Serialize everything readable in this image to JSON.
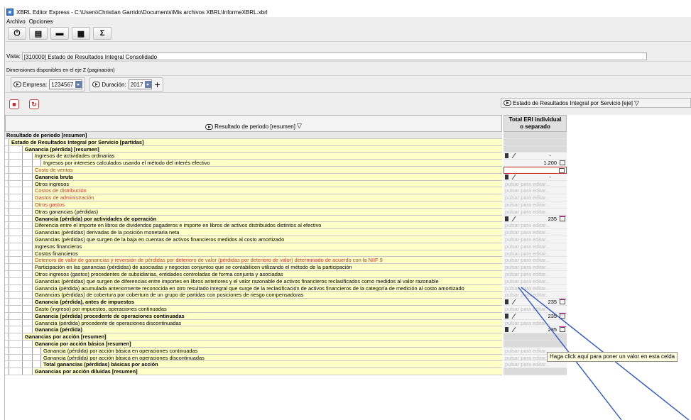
{
  "window": {
    "title": "XBRL Editor Express - C:\\Users\\Christian Garrido\\Documents\\Mis archivos XBRL\\InformeXBRL.xbrl"
  },
  "menu": [
    "Archivo",
    "Opciones"
  ],
  "toolbar": [
    {
      "icon": "power-icon",
      "glyph": "⏻"
    },
    {
      "icon": "open-file-icon",
      "glyph": "▤"
    },
    {
      "icon": "print-icon",
      "glyph": "▬"
    },
    {
      "icon": "table-icon",
      "glyph": "▦"
    },
    {
      "icon": "sigma-icon",
      "glyph": "Σ"
    }
  ],
  "vista": {
    "label": "Vista:",
    "value": "[310000] Estado de Resultados Integral Consolidado"
  },
  "dimensiones_label": "Dimensiones disponibles en el eje Z (paginación)",
  "dims": {
    "empresa_label": "Empresa:",
    "empresa_value": "1234567",
    "duracion_label": "Duración:",
    "duracion_value": "2017",
    "plus": "+"
  },
  "eri_header": "Estado de Resultados Integral por Servicio [eje]",
  "row_header": "Resultado de periodo [resumen]",
  "col_header": [
    "Total ERI individual",
    "o separado"
  ],
  "rows": [
    {
      "label": "Resultado de periodo [resumen]",
      "lvl": 0,
      "bold": true,
      "y": false,
      "red": false,
      "cell": {
        "t": "blank",
        "dark": true
      }
    },
    {
      "label": "Estado de Resultados Integral por Servicio [partidas]",
      "lvl": 1,
      "bold": true,
      "y": true,
      "red": false,
      "cell": {
        "t": "blank",
        "dark": true
      }
    },
    {
      "label": "Ganancia (pérdida) [resumen]",
      "lvl": 2,
      "bold": true,
      "y": true,
      "red": false,
      "cell": {
        "t": "blank",
        "dark": true
      }
    },
    {
      "label": "Ingresos de actividades ordinarias",
      "lvl": 3,
      "bold": false,
      "y": true,
      "red": false,
      "cell": {
        "t": "calc",
        "v": "-"
      }
    },
    {
      "label": "Ingresos por intereses calculados usando el método del interés efectivo",
      "lvl": 4,
      "bold": false,
      "y": true,
      "red": false,
      "cell": {
        "t": "val",
        "v": "1.200"
      }
    },
    {
      "label": "Costo de ventas",
      "lvl": 3,
      "bold": false,
      "y": true,
      "red": true,
      "cell": {
        "t": "edit",
        "v": ""
      }
    },
    {
      "label": "Ganancia bruta",
      "lvl": 3,
      "bold": true,
      "y": true,
      "red": false,
      "cell": {
        "t": "calc",
        "v": "-"
      }
    },
    {
      "label": "Otros ingresos",
      "lvl": 3,
      "bold": false,
      "y": true,
      "red": false,
      "cell": {
        "t": "ph"
      }
    },
    {
      "label": "Costos de distribución",
      "lvl": 3,
      "bold": false,
      "y": true,
      "red": true,
      "cell": {
        "t": "ph"
      }
    },
    {
      "label": "Gastos de administración",
      "lvl": 3,
      "bold": false,
      "y": true,
      "red": true,
      "cell": {
        "t": "ph"
      }
    },
    {
      "label": "Otros gastos",
      "lvl": 3,
      "bold": false,
      "y": true,
      "red": true,
      "cell": {
        "t": "ph"
      }
    },
    {
      "label": "Otras ganancias (pérdidas)",
      "lvl": 3,
      "bold": false,
      "y": true,
      "red": false,
      "cell": {
        "t": "ph"
      }
    },
    {
      "label": "Ganancia (pérdida) por actividades de operación",
      "lvl": 3,
      "bold": true,
      "y": true,
      "red": false,
      "cell": {
        "t": "calc",
        "v": "235"
      }
    },
    {
      "label": "Diferencia entre el importe en libros de dividendos pagaderos e importe en libros de activos distribuidos distintos al efectivo",
      "lvl": 3,
      "bold": false,
      "y": true,
      "red": false,
      "cell": {
        "t": "ph"
      }
    },
    {
      "label": "Ganancias (pérdidas) derivadas de la posición monetaria neta",
      "lvl": 3,
      "bold": false,
      "y": true,
      "red": false,
      "cell": {
        "t": "ph"
      }
    },
    {
      "label": "Ganancias (pérdidas) que surgen de la baja en cuentas de activos financieros medidos al costo amortizado",
      "lvl": 3,
      "bold": false,
      "y": true,
      "red": false,
      "cell": {
        "t": "ph"
      }
    },
    {
      "label": "Ingresos financieros",
      "lvl": 3,
      "bold": false,
      "y": true,
      "red": false,
      "cell": {
        "t": "ph"
      }
    },
    {
      "label": "Costos financieros",
      "lvl": 3,
      "bold": false,
      "y": true,
      "red": false,
      "cell": {
        "t": "ph"
      }
    },
    {
      "label": "Deterioro de valor de ganancias y reversión de pérdidas por deterioro de valor (pérdidas por deterioro de valor) determinado de acuerdo con la NIIF 9",
      "lvl": 3,
      "bold": false,
      "y": true,
      "red": true,
      "cell": {
        "t": "ph"
      }
    },
    {
      "label": "Participación en las ganancias (pérdidas) de asociadas y negocios conjuntos que se contabilicen utilizando el método de la participación",
      "lvl": 3,
      "bold": false,
      "y": true,
      "red": false,
      "cell": {
        "t": "ph"
      }
    },
    {
      "label": "Otros ingresos (gastos) procedentes de subsidiarias, entidades controladas de forma conjunta y asociadas",
      "lvl": 3,
      "bold": false,
      "y": true,
      "red": false,
      "cell": {
        "t": "ph"
      }
    },
    {
      "label": "Ganancias (pérdidas) que surgen de diferencias entre importes en libros anteriores y el valor razonable de activos financieros reclasificados como medidos al valor razonable",
      "lvl": 3,
      "bold": false,
      "y": true,
      "red": false,
      "cell": {
        "t": "ph"
      }
    },
    {
      "label": "Ganancia (pérdida) acumulada anteriormente reconocida en otro resultado integral que surge de la reclasificación de activos financieros de la categoría de medición al costo amortizado",
      "lvl": 3,
      "bold": false,
      "y": true,
      "red": false,
      "cell": {
        "t": "ph"
      }
    },
    {
      "label": "Ganancias (pérdidas) de cobertura por cobertura de un grupo de partidas con posiciones de riesgo compensadoras",
      "lvl": 3,
      "bold": false,
      "y": true,
      "red": false,
      "cell": {
        "t": "ph"
      }
    },
    {
      "label": "Ganancia (pérdida), antes de impuestos",
      "lvl": 3,
      "bold": true,
      "y": true,
      "red": false,
      "cell": {
        "t": "calc",
        "v": "235"
      }
    },
    {
      "label": "Gasto (ingreso) por impuestos, operaciones continuadas",
      "lvl": 3,
      "bold": false,
      "y": true,
      "red": false,
      "cell": {
        "t": "ph"
      }
    },
    {
      "label": "Ganancia (pérdida) procedente de operaciones continuadas",
      "lvl": 3,
      "bold": true,
      "y": true,
      "red": false,
      "cell": {
        "t": "calc",
        "v": "235"
      }
    },
    {
      "label": "Ganancia (pérdida) procedente de operaciones discontinuadas",
      "lvl": 3,
      "bold": false,
      "y": true,
      "red": false,
      "cell": {
        "t": "ph"
      }
    },
    {
      "label": "Ganancia (pérdida)",
      "lvl": 3,
      "bold": true,
      "y": true,
      "red": false,
      "cell": {
        "t": "calc",
        "v": "235"
      }
    },
    {
      "label": "Ganancias por acción [resumen]",
      "lvl": 2,
      "bold": true,
      "y": true,
      "red": false,
      "cell": {
        "t": "blank",
        "dark": true
      }
    },
    {
      "label": "Ganancia por acción básica [resumen]",
      "lvl": 3,
      "bold": true,
      "y": true,
      "red": false,
      "cell": {
        "t": "blank",
        "dark": true
      }
    },
    {
      "label": "Ganancia (pérdida) por acción básica en operaciones continuadas",
      "lvl": 4,
      "bold": false,
      "y": true,
      "red": false,
      "cell": {
        "t": "ph"
      }
    },
    {
      "label": "Ganancia (pérdida) por acción básica en operaciones discontinuadas",
      "lvl": 4,
      "bold": false,
      "y": true,
      "red": false,
      "cell": {
        "t": "ph"
      }
    },
    {
      "label": "Total ganancias (pérdidas) básicas por acción",
      "lvl": 4,
      "bold": true,
      "y": true,
      "red": false,
      "cell": {
        "t": "ph"
      }
    },
    {
      "label": "Ganancias por acción diluidas [resumen]",
      "lvl": 3,
      "bold": true,
      "y": true,
      "red": false,
      "cell": {
        "t": "blank",
        "dark": true
      }
    }
  ],
  "placeholder": "pulsar para editar...",
  "tooltip": "Haga click aquí para poner un valor en esta celda",
  "colors": {
    "yellow": "#ffffc8",
    "red_label": "#d23030",
    "callout": "#2f56c8"
  }
}
